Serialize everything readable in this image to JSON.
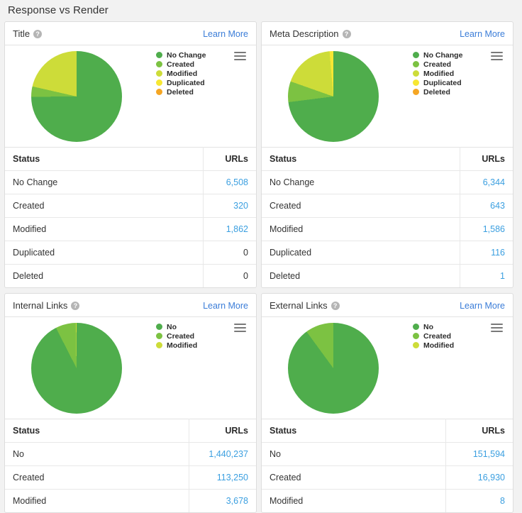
{
  "page": {
    "title": "Response vs Render"
  },
  "colors": {
    "no_change": "#4fad4c",
    "created": "#7cc242",
    "modified": "#cddc39",
    "duplicated": "#f7e733",
    "deleted": "#f5a623",
    "link": "#3b9fe0",
    "learn_more": "#3b7dd8"
  },
  "common": {
    "learn_more": "Learn More",
    "help_glyph": "?",
    "col_status": "Status",
    "col_urls": "URLs",
    "menu_icon": "hamburger-menu-icon"
  },
  "panels": [
    {
      "title": "Title",
      "rows": [
        {
          "label": "No Change",
          "value": "6,508",
          "link": true
        },
        {
          "label": "Created",
          "value": "320",
          "link": true
        },
        {
          "label": "Modified",
          "value": "1,862",
          "link": true
        },
        {
          "label": "Duplicated",
          "value": "0",
          "link": false
        },
        {
          "label": "Deleted",
          "value": "0",
          "link": false
        }
      ]
    },
    {
      "title": "Meta Description",
      "rows": [
        {
          "label": "No Change",
          "value": "6,344",
          "link": true
        },
        {
          "label": "Created",
          "value": "643",
          "link": true
        },
        {
          "label": "Modified",
          "value": "1,586",
          "link": true
        },
        {
          "label": "Duplicated",
          "value": "116",
          "link": true
        },
        {
          "label": "Deleted",
          "value": "1",
          "link": true
        }
      ]
    },
    {
      "title": "Internal Links",
      "rows": [
        {
          "label": "No",
          "value": "1,440,237",
          "link": true
        },
        {
          "label": "Created",
          "value": "113,250",
          "link": true
        },
        {
          "label": "Modified",
          "value": "3,678",
          "link": true
        }
      ]
    },
    {
      "title": "External Links",
      "rows": [
        {
          "label": "No",
          "value": "151,594",
          "link": true
        },
        {
          "label": "Created",
          "value": "16,930",
          "link": true
        },
        {
          "label": "Modified",
          "value": "8",
          "link": true
        }
      ]
    }
  ],
  "chart_data": [
    {
      "type": "pie",
      "title": "Title",
      "labels": [
        "No Change",
        "Created",
        "Modified",
        "Duplicated",
        "Deleted"
      ],
      "values": [
        6508,
        320,
        1862,
        0,
        0
      ],
      "colors": [
        "#4fad4c",
        "#7cc242",
        "#cddc39",
        "#f7e733",
        "#f5a623"
      ],
      "legend_position": "right"
    },
    {
      "type": "pie",
      "title": "Meta Description",
      "labels": [
        "No Change",
        "Created",
        "Modified",
        "Duplicated",
        "Deleted"
      ],
      "values": [
        6344,
        643,
        1586,
        116,
        1
      ],
      "colors": [
        "#4fad4c",
        "#7cc242",
        "#cddc39",
        "#f7e733",
        "#f5a623"
      ],
      "legend_position": "right"
    },
    {
      "type": "pie",
      "title": "Internal Links",
      "labels": [
        "No",
        "Created",
        "Modified"
      ],
      "values": [
        1440237,
        113250,
        3678
      ],
      "colors": [
        "#4fad4c",
        "#7cc242",
        "#cddc39"
      ],
      "legend_position": "right"
    },
    {
      "type": "pie",
      "title": "External Links",
      "labels": [
        "No",
        "Created",
        "Modified"
      ],
      "values": [
        151594,
        16930,
        8
      ],
      "colors": [
        "#4fad4c",
        "#7cc242",
        "#cddc39"
      ],
      "legend_position": "right"
    }
  ]
}
